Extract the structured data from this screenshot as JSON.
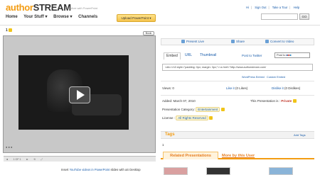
{
  "header": {
    "logo_part1": "author",
    "logo_part2": "STREAM",
    "tagline": "Do More with PowerPoint",
    "links": [
      "Hi",
      "Sign Out",
      "Take a Tour",
      "Help"
    ],
    "search_placeholder": "",
    "go_label": "GO",
    "nav": [
      "Home",
      "Your Stuff ▾",
      "Browse ▾",
      "Channels"
    ],
    "upload_label": "Upload PowerPoint ▾"
  },
  "presentation": {
    "rating_label": "1",
    "bookmark_label": "Book",
    "controls": [
      "◄",
      "1 OF 1",
      "►",
      "⟲",
      "⤢"
    ],
    "bottom_note_prefix": "Insert",
    "bottom_note_link": "YouTube videos in PowerPoint",
    "bottom_note_suffix": "slides with aS Desktop"
  },
  "actions": {
    "present_live": "Present Live",
    "share": "Share",
    "convert": "Convert to Video"
  },
  "embed": {
    "tabs": [
      "Embed",
      "URL",
      "Thumbnail"
    ],
    "twitter": "Post to Twitter",
    "post_to": "Post to",
    "code": "<div><h3 style=\"padding: 0px; margin: 3px;\"><a href=\"http://www.authorstream.com/",
    "wordpress_link": "WordPress Embed",
    "custom_link": "Custom Embed"
  },
  "stats": {
    "views": "Views: 0",
    "like": "Like it",
    "like_count": "(0 Likes)",
    "dislike": "Dislike it",
    "dislike_count": "(0 Dislikes)"
  },
  "details": {
    "added": "Added: March 07, 2010",
    "privacy_prefix": "This Presentation is",
    "privacy_value": "Private",
    "category_label": "Presentation Category:",
    "category_value": "Entertainment",
    "license_label": "License :",
    "license_value": "All Rights Reserved"
  },
  "tags": {
    "title": "Tags",
    "add_label": "Add Tags",
    "count": "1"
  },
  "related": {
    "tab1": "Related Presentations",
    "tab2": "More by this User"
  },
  "colors": {
    "accent": "#f39c12",
    "link": "#1a5dab",
    "private": "#c0392b"
  }
}
